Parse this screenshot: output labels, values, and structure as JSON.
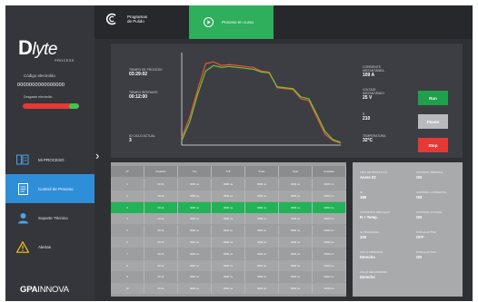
{
  "brand": {
    "logo_main": "D",
    "logo_rest": "lyte",
    "logo_sub": "PROCESS",
    "company_bold": "GPA",
    "company_light": "INNOVA"
  },
  "sidebar": {
    "electrode_label": "Código electrolito",
    "electrode_code": "0000000000000000",
    "wear_label": "Desgaste electrolito",
    "wear_level": 0.18,
    "nav": [
      {
        "label": "Mi PROCESO",
        "icon": "process-icon"
      },
      {
        "label": "Control de Proceso",
        "icon": "document-icon"
      },
      {
        "label": "Soporte Técnico",
        "icon": "support-icon"
      },
      {
        "label": "Alertas",
        "icon": "warning-icon"
      }
    ],
    "active_index": 1
  },
  "topbar": {
    "programs_label": "Programas de Pulido",
    "process_label": "Proceso en curso"
  },
  "process": {
    "left_stats": [
      {
        "label": "TIEMPO DE PROCESO",
        "value": "03:29:02"
      },
      {
        "label": "TIEMPO RESTANTE",
        "value": "00:12:00"
      },
      {
        "label": "ID CICLO ACTUAL",
        "value": "3"
      }
    ],
    "right_stats": [
      {
        "label": "CORRIENTE INSTANTÁNEA",
        "value": "109 A"
      },
      {
        "label": "VOLTAJE INSTANTÁNEO",
        "value": "25 V"
      },
      {
        "label": "R",
        "value": "210"
      },
      {
        "label": "TEMPERATURA",
        "value": "32°C"
      }
    ],
    "buttons": {
      "run": "Run",
      "pause": "Pause",
      "stop": "Stop"
    },
    "colors": {
      "run": "#1fa04a",
      "pause": "#b8babd",
      "stop": "#e53935",
      "accent": "#2fae5b"
    }
  },
  "chart_data": {
    "type": "line",
    "title": "",
    "xlabel": "",
    "ylabel": "",
    "x": [
      0,
      1,
      2,
      3,
      4,
      5,
      6,
      7,
      8,
      9,
      10,
      11,
      12,
      13,
      14,
      15,
      16,
      17,
      18,
      19,
      20
    ],
    "series": [
      {
        "values": [
          8,
          30,
          60,
          88,
          90,
          86,
          87,
          86,
          85,
          84,
          80,
          79,
          62,
          61,
          60,
          50,
          48,
          30,
          12,
          5,
          2
        ],
        "color": "#e05a3a"
      },
      {
        "values": [
          5,
          25,
          55,
          80,
          86,
          84,
          85,
          84,
          83,
          82,
          79,
          78,
          63,
          62,
          61,
          52,
          50,
          33,
          15,
          6,
          3
        ],
        "color": "#7bbf3a"
      }
    ],
    "ylim": [
      0,
      100
    ],
    "grid": false
  },
  "table": {
    "headers": [
      "Nº",
      "Duración",
      "Ton",
      "Toff",
      "Vmax",
      "Imax",
      "Cuspides"
    ],
    "rows": [
      [
        "1",
        "00:11",
        "0000 us",
        "0000 us",
        "0000 us",
        "0000 us",
        "0000 ms"
      ],
      [
        "2",
        "00:11",
        "0000 us",
        "0000 us",
        "0000 us",
        "0000 us",
        "0000 ms"
      ],
      [
        "3",
        "00:11",
        "0000 us",
        "0000 us",
        "0000 us",
        "0000 us",
        "0000 ms"
      ],
      [
        "4",
        "00:11",
        "0000 us",
        "0000 us",
        "0000 us",
        "0000 us",
        "0000 ms"
      ],
      [
        "5",
        "00:11",
        "0000 us",
        "0000 us",
        "0000 us",
        "0000 us",
        "0000 ms"
      ],
      [
        "6",
        "00:11",
        "0000 us",
        "0000 us",
        "0000 us",
        "0000 us",
        "0000 ms"
      ],
      [
        "7",
        "00:11",
        "0000 us",
        "0000 us",
        "0000 us",
        "0000 us",
        "0000 ms"
      ],
      [
        "8",
        "00:11",
        "0000 us",
        "0000 us",
        "0000 us",
        "0000 us",
        "0000 ms"
      ],
      [
        "9",
        "00:11",
        "0000 us",
        "0000 us",
        "0000 us",
        "0000 us",
        "0000 ms"
      ],
      [
        "10",
        "00:11",
        "0000 us",
        "0000 us",
        "0000 us",
        "0000 us",
        "0000 ms"
      ]
    ],
    "selected_row": 2
  },
  "params": {
    "left": [
      {
        "label": "TIPO DE PRODUCTO",
        "value": "Acero 02"
      },
      {
        "label": "ID",
        "value": "188"
      },
      {
        "label": "CONDICIÓN PROCESO",
        "value": "R + Temp."
      },
      {
        "label": "ID PROGRAMA",
        "value": "100"
      },
      {
        "label": "CICLO PRINCIPAL",
        "value": "Derecho"
      },
      {
        "label": "CICLO SECUNDARIO",
        "value": "Derecho"
      }
    ],
    "right": [
      {
        "label": "CONTROL TÉRMICO",
        "value": "ON"
      },
      {
        "label": "CONTROL CORRIENTE",
        "value": "ON"
      },
      {
        "label": "CONTROL VOLTAJE",
        "value": "ON"
      },
      {
        "label": "PURGA ACTIVA",
        "value": "OFF"
      },
      {
        "label": "PURGA ACTIVA",
        "value": "ON"
      }
    ]
  }
}
